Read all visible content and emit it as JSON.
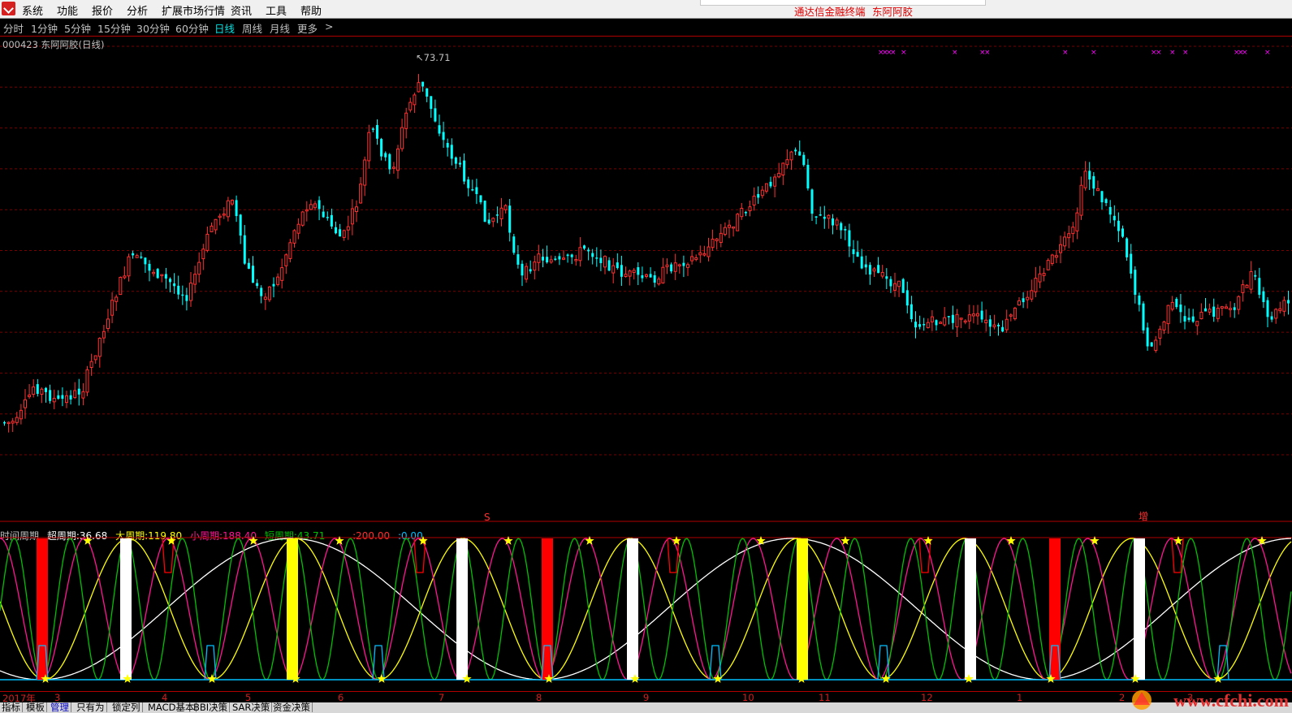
{
  "menu": {
    "items": [
      "系统",
      "功能",
      "报价",
      "分析",
      "扩展市场行情",
      "资讯",
      "工具",
      "帮助"
    ],
    "brand": "通达信金融终端",
    "stock": "东阿阿胶"
  },
  "periods": {
    "tabs": [
      "分时",
      "1分钟",
      "5分钟",
      "15分钟",
      "30分钟",
      "60分钟",
      "日线",
      "周线",
      "月线",
      "更多"
    ],
    "active": "日线",
    "more_arrow": ">"
  },
  "chart": {
    "caption": "000423 东阿阿胶(日线)",
    "high_marker": "73.71",
    "signal_sell": "S",
    "signal_add": "增",
    "colors": {
      "up": "#ff3030",
      "down": "#00ffff",
      "grid": "#800000",
      "marker": "#ff00ff"
    }
  },
  "indicator": {
    "name": "时间周期",
    "items": [
      {
        "label": "超周期:",
        "value": "36.68",
        "color": "#ffffff"
      },
      {
        "label": "大周期:",
        "value": "119.80",
        "color": "#ffff00"
      },
      {
        "label": "小周期:",
        "value": "188.40",
        "color": "#ff1493"
      },
      {
        "label": "短周期:",
        "value": "43.71",
        "color": "#00c000"
      },
      {
        "label": ":",
        "value": "200.00",
        "color": "#ff3030"
      },
      {
        "label": ":",
        "value": "0.00",
        "color": "#00bfff"
      }
    ]
  },
  "xaxis": {
    "labels": [
      "2017年",
      "3",
      "4",
      "5",
      "6",
      "7",
      "8",
      "9",
      "10",
      "11",
      "12",
      "1",
      "2",
      "3"
    ]
  },
  "bottom_tabs": {
    "items": [
      "指标",
      "模板",
      "管理",
      "只有为",
      "锁定列",
      "MACD基本",
      "BBI决策",
      "SAR决策",
      "资金决策"
    ],
    "active": "管理"
  },
  "watermark": "www.cfchi.com"
}
